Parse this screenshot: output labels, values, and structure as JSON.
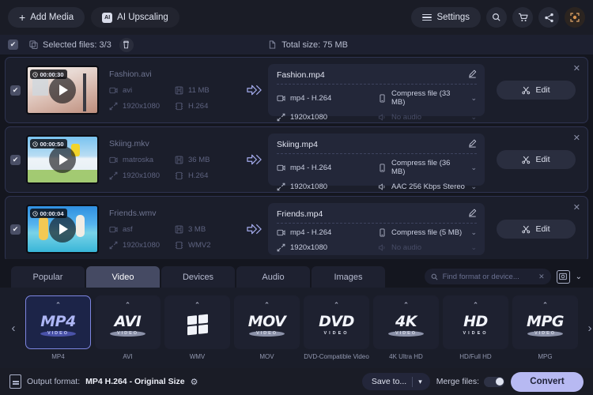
{
  "topbar": {
    "add_media": "Add Media",
    "ai_upscaling": "AI Upscaling",
    "settings": "Settings",
    "ai_badge": "AI"
  },
  "selected_bar": {
    "selected_files": "Selected files: 3/3",
    "total_size": "Total size: 75 MB"
  },
  "files": [
    {
      "duration": "00:00:30",
      "source_name": "Fashion.avi",
      "container": "avi",
      "size": "11 MB",
      "resolution": "1920x1080",
      "codec": "H.264",
      "out_name": "Fashion.mp4",
      "out_format": "mp4 - H.264",
      "out_resolution": "1920x1080",
      "out_compress": "Compress file (33 MB)",
      "out_audio": "No audio",
      "audio_dim": true,
      "edit_label": "Edit"
    },
    {
      "duration": "00:00:50",
      "source_name": "Skiing.mkv",
      "container": "matroska",
      "size": "36 MB",
      "resolution": "1920x1080",
      "codec": "H.264",
      "out_name": "Skiing.mp4",
      "out_format": "mp4 - H.264",
      "out_resolution": "1920x1080",
      "out_compress": "Compress file (36 MB)",
      "out_audio": "AAC 256 Kbps Stereo",
      "audio_dim": false,
      "edit_label": "Edit"
    },
    {
      "duration": "00:00:04",
      "source_name": "Friends.wmv",
      "container": "asf",
      "size": "3 MB",
      "resolution": "1920x1080",
      "codec": "WMV2",
      "out_name": "Friends.mp4",
      "out_format": "mp4 - H.264",
      "out_resolution": "1920x1080",
      "out_compress": "Compress file (5 MB)",
      "out_audio": "No audio",
      "audio_dim": true,
      "edit_label": "Edit"
    }
  ],
  "tabs": [
    {
      "label": "Popular",
      "active": false
    },
    {
      "label": "Video",
      "active": true
    },
    {
      "label": "Devices",
      "active": false
    },
    {
      "label": "Audio",
      "active": false
    },
    {
      "label": "Images",
      "active": false
    }
  ],
  "search": {
    "placeholder": "Find format or device...",
    "value": ""
  },
  "formats": [
    {
      "logo": "MP4",
      "sub": "VIDEO",
      "label": "MP4",
      "selected": true,
      "style": "text"
    },
    {
      "logo": "AVI",
      "sub": "VIDEO",
      "label": "AVI",
      "selected": false,
      "style": "text"
    },
    {
      "logo": "",
      "sub": "",
      "label": "WMV",
      "selected": false,
      "style": "windows"
    },
    {
      "logo": "MOV",
      "sub": "VIDEO",
      "label": "MOV",
      "selected": false,
      "style": "text"
    },
    {
      "logo": "DVD",
      "sub": "VIDEO",
      "label": "DVD-Compatible Video",
      "selected": false,
      "style": "text-below"
    },
    {
      "logo": "4K",
      "sub": "VIDEO",
      "label": "4K Ultra HD",
      "selected": false,
      "style": "text"
    },
    {
      "logo": "HD",
      "sub": "VIDEO",
      "label": "HD/Full HD",
      "selected": false,
      "style": "text-below"
    },
    {
      "logo": "MPG",
      "sub": "VIDEO",
      "label": "MPG",
      "selected": false,
      "style": "text"
    }
  ],
  "bottom": {
    "output_format_label": "Output format:",
    "output_format_value": "MP4 H.264 - Original Size",
    "save_to": "Save to...",
    "merge_files": "Merge files:",
    "convert": "Convert"
  },
  "colors": {
    "accent": "#7d85e0",
    "convert_bg": "#b7b9f2",
    "panel": "#1b1e2b",
    "background": "#14161f"
  }
}
